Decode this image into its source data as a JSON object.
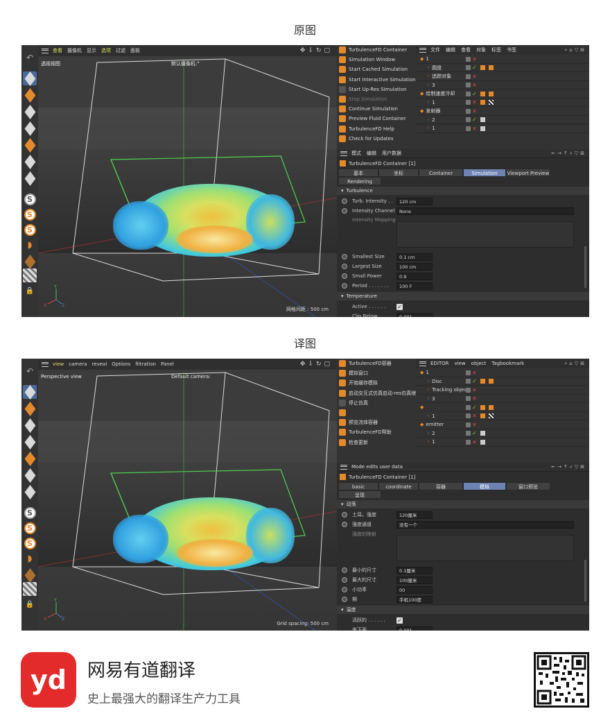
{
  "sections": {
    "original": "原图",
    "translated": "译图"
  },
  "original": {
    "viewport": {
      "menu": [
        "查看",
        "摄像机",
        "显示",
        "选项",
        "过滤",
        "面板"
      ],
      "view_label": "透视视图",
      "camera_label": "默认摄像机:°",
      "grid_label": "网格间距 : 500 cm"
    },
    "plugin_menu": [
      {
        "label": "TurbulenceFD Container",
        "disabled": false
      },
      {
        "label": "Simulation Window",
        "disabled": false
      },
      {
        "label": "Start Cached Simulation",
        "disabled": false
      },
      {
        "label": "Start Interactive Simulation",
        "disabled": false
      },
      {
        "label": "Start Up-Res Simulation",
        "disabled": false
      },
      {
        "label": "Stop Simulation",
        "disabled": true
      },
      {
        "label": "Continue Simulation",
        "disabled": false
      },
      {
        "label": "Preview Fluid Container",
        "disabled": false
      },
      {
        "label": "TurbulenceFD Help",
        "disabled": false
      },
      {
        "label": "Check for Updates",
        "disabled": false
      }
    ],
    "object_manager": {
      "menu": [
        "文件",
        "编辑",
        "查看",
        "对象",
        "标签",
        "书签"
      ],
      "rows": [
        {
          "name": "1",
          "indent": 0
        },
        {
          "name": "圆盘",
          "indent": 1
        },
        {
          "name": "追踪对象",
          "indent": 1
        },
        {
          "name": "3",
          "indent": 1
        },
        {
          "name": "绘制速度冷却",
          "indent": 0
        },
        {
          "name": "1",
          "indent": 1
        },
        {
          "name": "发射器",
          "indent": 0
        },
        {
          "name": "2",
          "indent": 1
        },
        {
          "name": "1",
          "indent": 1
        }
      ]
    },
    "attributes": {
      "menu": [
        "模式",
        "编辑",
        "用户数据"
      ],
      "title": "TurbulenceFD Container [1]",
      "tabs": [
        "基本",
        "坐标",
        "Container",
        "Simulation",
        "Viewport Preview"
      ],
      "tab2": "Rendering",
      "section1": "Turbulence",
      "params": [
        {
          "label": "Turb. Intensity . .",
          "value": "120 cm"
        },
        {
          "label": "Intensity Channel",
          "value": "None"
        },
        {
          "label": "Intensity Mapping",
          "value": ""
        },
        {
          "label": "Smallest Size",
          "value": "0.1 cm"
        },
        {
          "label": "Largest Size",
          "value": "100 cm"
        },
        {
          "label": "Small Power",
          "value": "0.9"
        },
        {
          "label": "Period . . . . . . .",
          "value": "100 F"
        }
      ],
      "section2": "Temperature",
      "active_label": "Active . . . . . .",
      "clip_label": "Clip Below",
      "clip_value": "0.001"
    }
  },
  "translated": {
    "viewport": {
      "menu": [
        "view",
        "camera",
        "reveal",
        "Options",
        "filtration",
        "Panel"
      ],
      "view_label": "Perspective view",
      "camera_label": "Default camera:",
      "grid_label": "Grid spacing: 500 cm"
    },
    "plugin_menu": [
      {
        "label": "TurbulenceFD容器",
        "disabled": false
      },
      {
        "label": "模拟窗口",
        "disabled": false
      },
      {
        "label": "开始缓存模拟",
        "disabled": false
      },
      {
        "label": "启动交互式仿真启动-res仿真继续仿真",
        "disabled": false
      },
      {
        "label": "停止仿真",
        "disabled": false
      },
      {
        "label": "",
        "disabled": false
      },
      {
        "label": "预览流体容器",
        "disabled": false
      },
      {
        "label": "TurbulenceFD帮助",
        "disabled": false
      },
      {
        "label": "检查更新",
        "disabled": false
      }
    ],
    "object_manager": {
      "menu": [
        "EDITOR",
        "view",
        "object",
        "Tagbookmark"
      ],
      "rows": [
        {
          "name": "1",
          "indent": 0
        },
        {
          "name": "Disc",
          "indent": 1
        },
        {
          "name": "Tracking object",
          "indent": 1
        },
        {
          "name": "3",
          "indent": 1
        },
        {
          "name": "",
          "indent": 0
        },
        {
          "name": "1",
          "indent": 1
        },
        {
          "name": "emitter",
          "indent": 0
        },
        {
          "name": "2",
          "indent": 1
        },
        {
          "name": "1",
          "indent": 1
        }
      ]
    },
    "attributes": {
      "menu": [
        "Mode edits user data"
      ],
      "title": "TurbulenceFD Container [1]",
      "tabs": [
        "basic",
        "coordinate",
        "容器",
        "模拟",
        "窗口预览"
      ],
      "tab2": "呈现",
      "section1": "动荡",
      "params": [
        {
          "label": "土耳。强度",
          "value": "120厘米"
        },
        {
          "label": "强度通道",
          "value": "没有一个"
        },
        {
          "label": "强度的映射",
          "value": ""
        },
        {
          "label": "最小的尺寸",
          "value": "0.1厘米"
        },
        {
          "label": "最大的尺寸",
          "value": "100厘米"
        },
        {
          "label": "小功率",
          "value": "00"
        },
        {
          "label": "期",
          "value": "手机100度"
        }
      ],
      "section2": "温度",
      "active_label": "活跃的 . . . . . .",
      "clip_label": "夹下面",
      "clip_value": "0.001"
    }
  },
  "brand": {
    "logo_text": "yd",
    "name": "网易有道翻译",
    "slogan": "史上最强大的翻译生产力工具"
  }
}
